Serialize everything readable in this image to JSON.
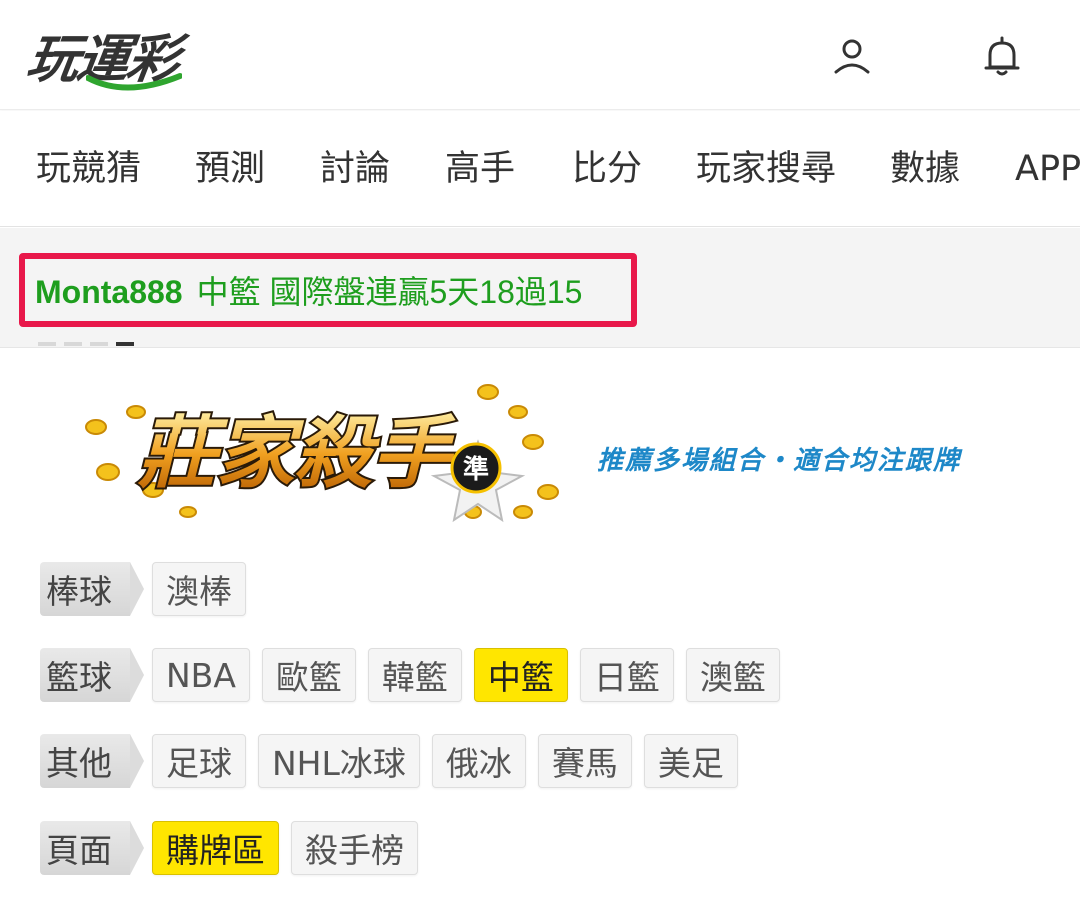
{
  "header": {
    "logo_text": "玩運彩",
    "icons": [
      "user-icon",
      "bell-icon"
    ]
  },
  "nav": {
    "items": [
      "玩競猜",
      "預測",
      "討論",
      "高手",
      "比分",
      "玩家搜尋",
      "數據",
      "APP"
    ]
  },
  "announcement": {
    "user": "Monta888",
    "message": "中籃 國際盤連贏5天18過15",
    "slide_count": 4,
    "active_slide": 4
  },
  "banner": {
    "title": "莊家殺手",
    "badge": "準",
    "slogan": "推薦多場組合・適合均注跟牌"
  },
  "filters": {
    "rows": [
      {
        "label": "棒球",
        "chips": [
          {
            "text": "澳棒",
            "active": false
          }
        ]
      },
      {
        "label": "籃球",
        "chips": [
          {
            "text": "NBA",
            "active": false
          },
          {
            "text": "歐籃",
            "active": false
          },
          {
            "text": "韓籃",
            "active": false
          },
          {
            "text": "中籃",
            "active": true
          },
          {
            "text": "日籃",
            "active": false
          },
          {
            "text": "澳籃",
            "active": false
          }
        ]
      },
      {
        "label": "其他",
        "chips": [
          {
            "text": "足球",
            "active": false
          },
          {
            "text": "NHL冰球",
            "active": false
          },
          {
            "text": "俄冰",
            "active": false
          },
          {
            "text": "賽馬",
            "active": false
          },
          {
            "text": "美足",
            "active": false
          }
        ]
      },
      {
        "label": "頁面",
        "chips": [
          {
            "text": "購牌區",
            "active": true
          },
          {
            "text": "殺手榜",
            "active": false
          }
        ]
      }
    ]
  },
  "colors": {
    "announcement_text": "#1e9e1e",
    "highlight_border": "#e8184a",
    "active_chip": "#ffe600",
    "slogan": "#1e88c8"
  }
}
